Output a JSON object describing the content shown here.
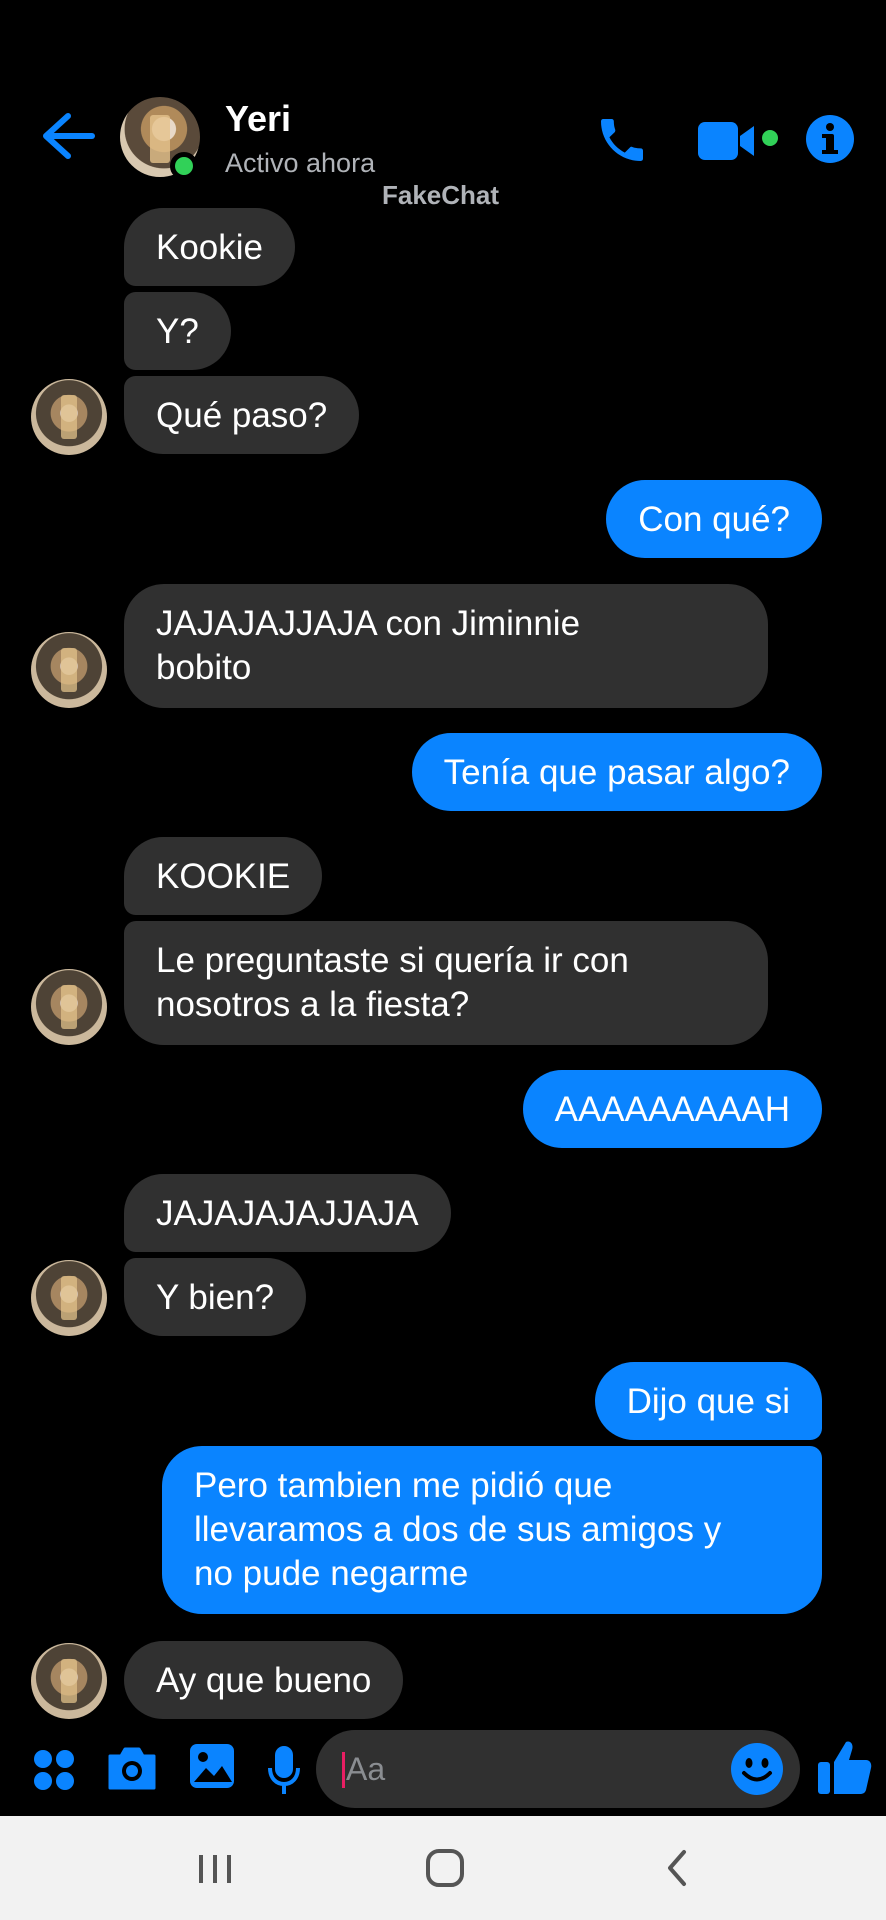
{
  "header": {
    "contact_name": "Yeri",
    "status": "Activo ahora",
    "watermark": "FakeChat",
    "accent_color": "#0a84ff",
    "online_color": "#31d158",
    "icons": [
      "back-arrow-icon",
      "phone-icon",
      "video-camera-icon",
      "info-icon"
    ]
  },
  "messages": [
    {
      "dir": "in",
      "text": "Kookie"
    },
    {
      "dir": "in",
      "text": "Y?"
    },
    {
      "dir": "in",
      "text": "Qué paso?"
    },
    {
      "dir": "out",
      "text": "Con qué?"
    },
    {
      "dir": "in",
      "text": "JAJAJAJJAJA con Jiminnie\nbobito"
    },
    {
      "dir": "out",
      "text": "Tenía que pasar algo?"
    },
    {
      "dir": "in",
      "text": "KOOKIE"
    },
    {
      "dir": "in",
      "text": "Le preguntaste si quería ir con\nnosotros a la fiesta?"
    },
    {
      "dir": "out",
      "text": "AAAAAAAAAH"
    },
    {
      "dir": "in",
      "text": "JAJAJAJAJJAJA"
    },
    {
      "dir": "in",
      "text": "Y bien?"
    },
    {
      "dir": "out",
      "text": "Dijo que si"
    },
    {
      "dir": "out",
      "text": "Pero tambien me pidió que\nllevaramos a dos de sus amigos y\nno pude negarme"
    },
    {
      "dir": "in",
      "text": "Ay que bueno"
    }
  ],
  "composer": {
    "placeholder": "Aa",
    "icons": [
      "apps-icon",
      "camera-icon",
      "gallery-icon",
      "microphone-icon",
      "emoji-icon",
      "thumbs-up-icon"
    ]
  },
  "navbar": {
    "icons": [
      "recent-apps-icon",
      "home-icon",
      "back-icon"
    ]
  }
}
